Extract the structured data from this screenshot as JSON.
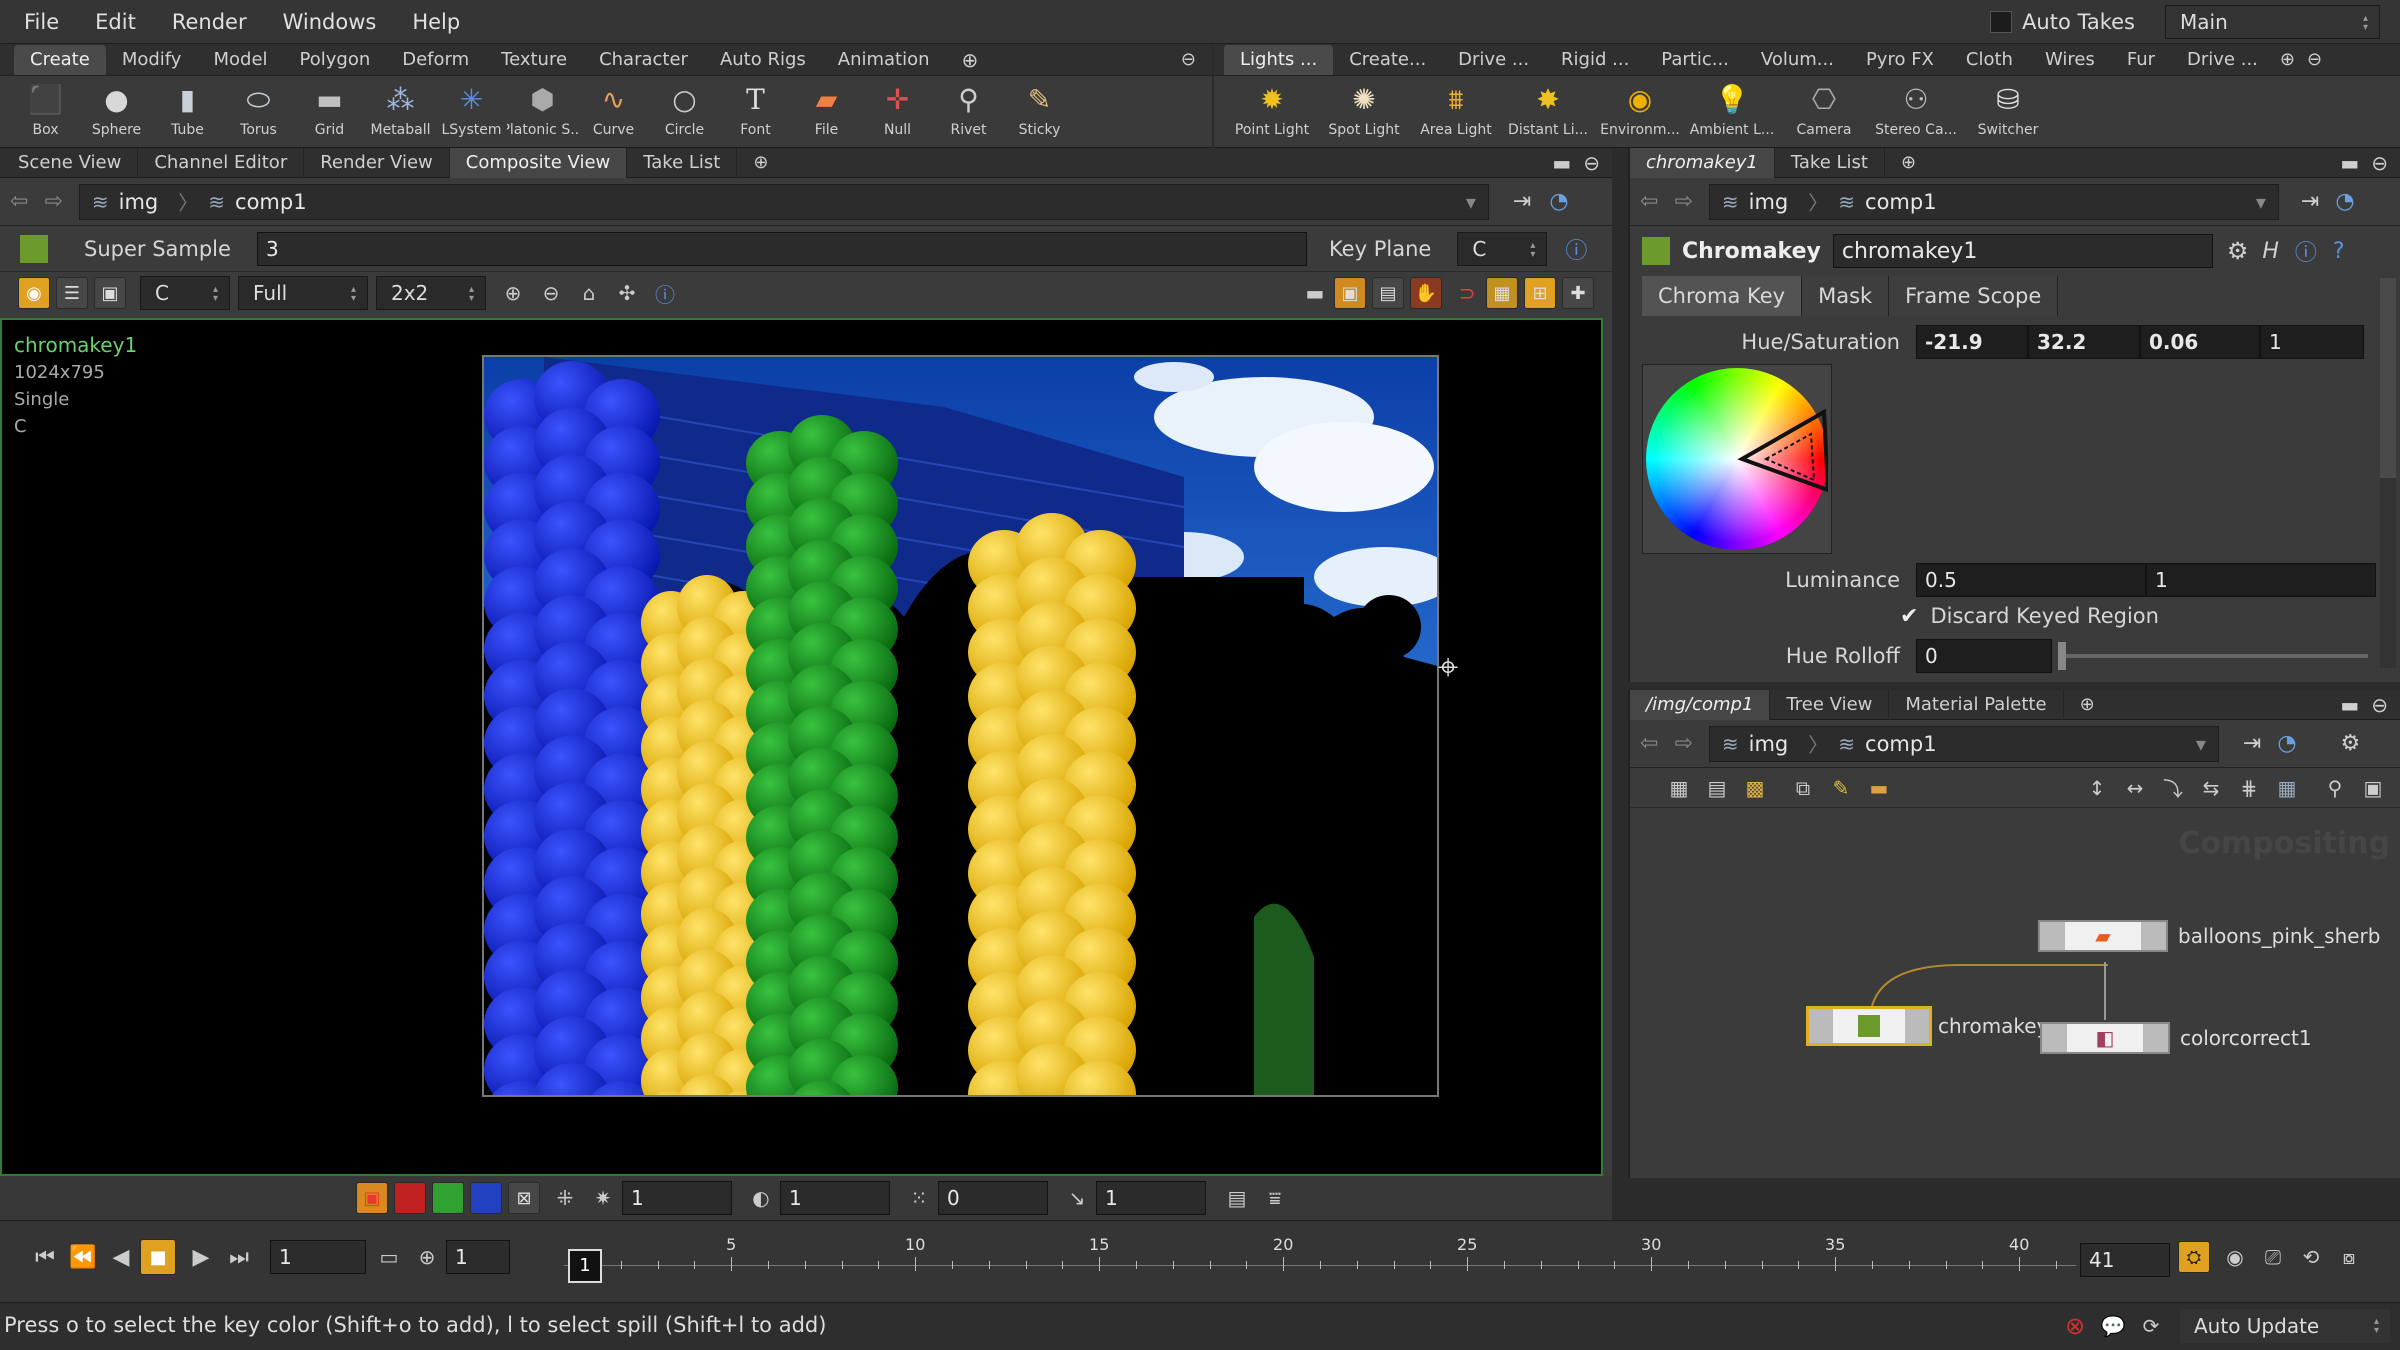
{
  "menu": [
    "File",
    "Edit",
    "Render",
    "Windows",
    "Help"
  ],
  "top_right": {
    "auto_takes": "Auto Takes",
    "desktop": "Main"
  },
  "shelf_left": {
    "tabs": [
      "Create",
      "Modify",
      "Model",
      "Polygon",
      "Deform",
      "Texture",
      "Character",
      "Auto Rigs",
      "Animation"
    ],
    "tools": [
      "Box",
      "Sphere",
      "Tube",
      "Torus",
      "Grid",
      "Metaball",
      "LSystem",
      "Platonic S...",
      "Curve",
      "Circle",
      "Font",
      "File",
      "Null",
      "Rivet",
      "Sticky"
    ]
  },
  "shelf_right": {
    "tabs": [
      "Lights ...",
      "Create...",
      "Drive ...",
      "Rigid ...",
      "Partic...",
      "Volum...",
      "Pyro FX",
      "Cloth",
      "Wires",
      "Fur",
      "Drive ..."
    ],
    "tools": [
      "Point Light",
      "Spot Light",
      "Area Light",
      "Distant Li...",
      "Environm...",
      "Ambient L...",
      "Camera",
      "Stereo Ca...",
      "Switcher"
    ]
  },
  "left_pane": {
    "tabs": [
      "Scene View",
      "Channel Editor",
      "Render View",
      "Composite View",
      "Take List"
    ],
    "path": [
      "img",
      "comp1"
    ],
    "super_sample_label": "Super Sample",
    "super_sample_value": "3",
    "key_plane_label": "Key Plane",
    "key_plane_value": "C",
    "plane_value": "C",
    "res_value": "Full",
    "grid_value": "2x2"
  },
  "viewer_info": {
    "node": "chromakey1",
    "resolution": "1024x795",
    "mode": "Single",
    "plane": "C"
  },
  "viewer_bottom": {
    "v1": "1",
    "v2": "1",
    "v3": "0",
    "v4": "1"
  },
  "timeline": {
    "frame": "1",
    "start": "1",
    "range_start": "1",
    "end": "41",
    "ticks": [
      "5",
      "10",
      "15",
      "20",
      "25",
      "30",
      "35",
      "40"
    ],
    "current_marker": "1"
  },
  "param_pane": {
    "tabs": [
      "chromakey1",
      "Take List"
    ],
    "path": [
      "img",
      "comp1"
    ],
    "node_type": "Chromakey",
    "node_name": "chromakey1",
    "subtabs": [
      "Chroma Key",
      "Mask",
      "Frame Scope"
    ],
    "hue_sat_label": "Hue/Saturation",
    "hue_sat": [
      "-21.9",
      "32.2",
      "0.06",
      "1"
    ],
    "luminance_label": "Luminance",
    "luminance": [
      "0.5",
      "1"
    ],
    "discard_label": "Discard Keyed Region",
    "hue_rolloff_label": "Hue Rolloff",
    "hue_rolloff": "0"
  },
  "network_pane": {
    "tabs": [
      "/img/comp1",
      "Tree View",
      "Material Palette"
    ],
    "path": [
      "img",
      "comp1"
    ],
    "watermark": "Compositing",
    "nodes": [
      "balloons_pink_sherb",
      "chromakey1",
      "colorcorrect1"
    ]
  },
  "status": {
    "message": "Press o to select the key color (Shift+o to add), l to select spill (Shift+l to add)",
    "update": "Auto Update"
  }
}
